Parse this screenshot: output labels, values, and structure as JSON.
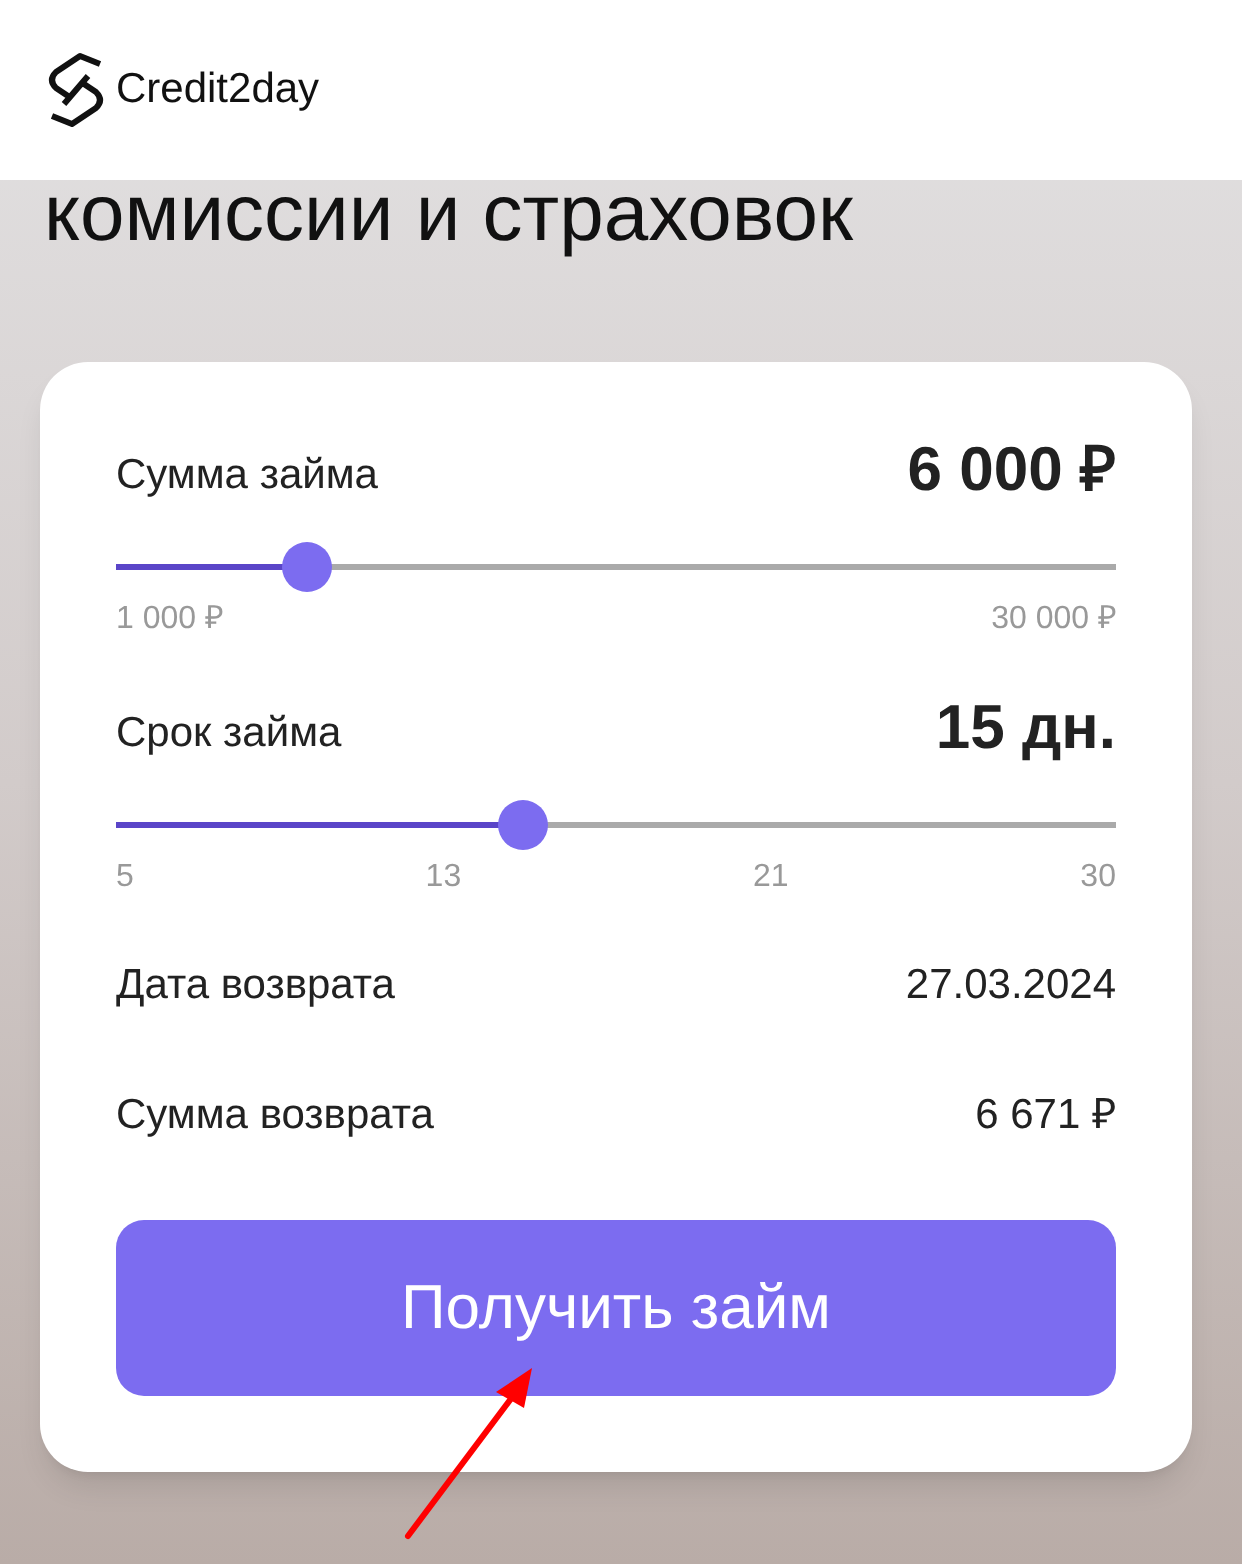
{
  "header": {
    "logo_text": "Credit2day"
  },
  "heading": "комиссии и страховок",
  "calculator": {
    "sliders": [
      {
        "label": "Сумма займа",
        "value": "6 000 ₽",
        "level": 0.19,
        "ticks": [
          "1 000 ₽",
          "30 000 ₽"
        ]
      },
      {
        "label": "Срок займа",
        "value": "15 дн.",
        "level": 0.406,
        "ticks": [
          "5",
          "13",
          "21",
          "30"
        ]
      }
    ],
    "details": [
      {
        "label": "Дата возврата",
        "value": "27.03.2024"
      },
      {
        "label": "Сумма возврата",
        "value": "6 671 ₽"
      }
    ],
    "button": "Получить займ"
  }
}
